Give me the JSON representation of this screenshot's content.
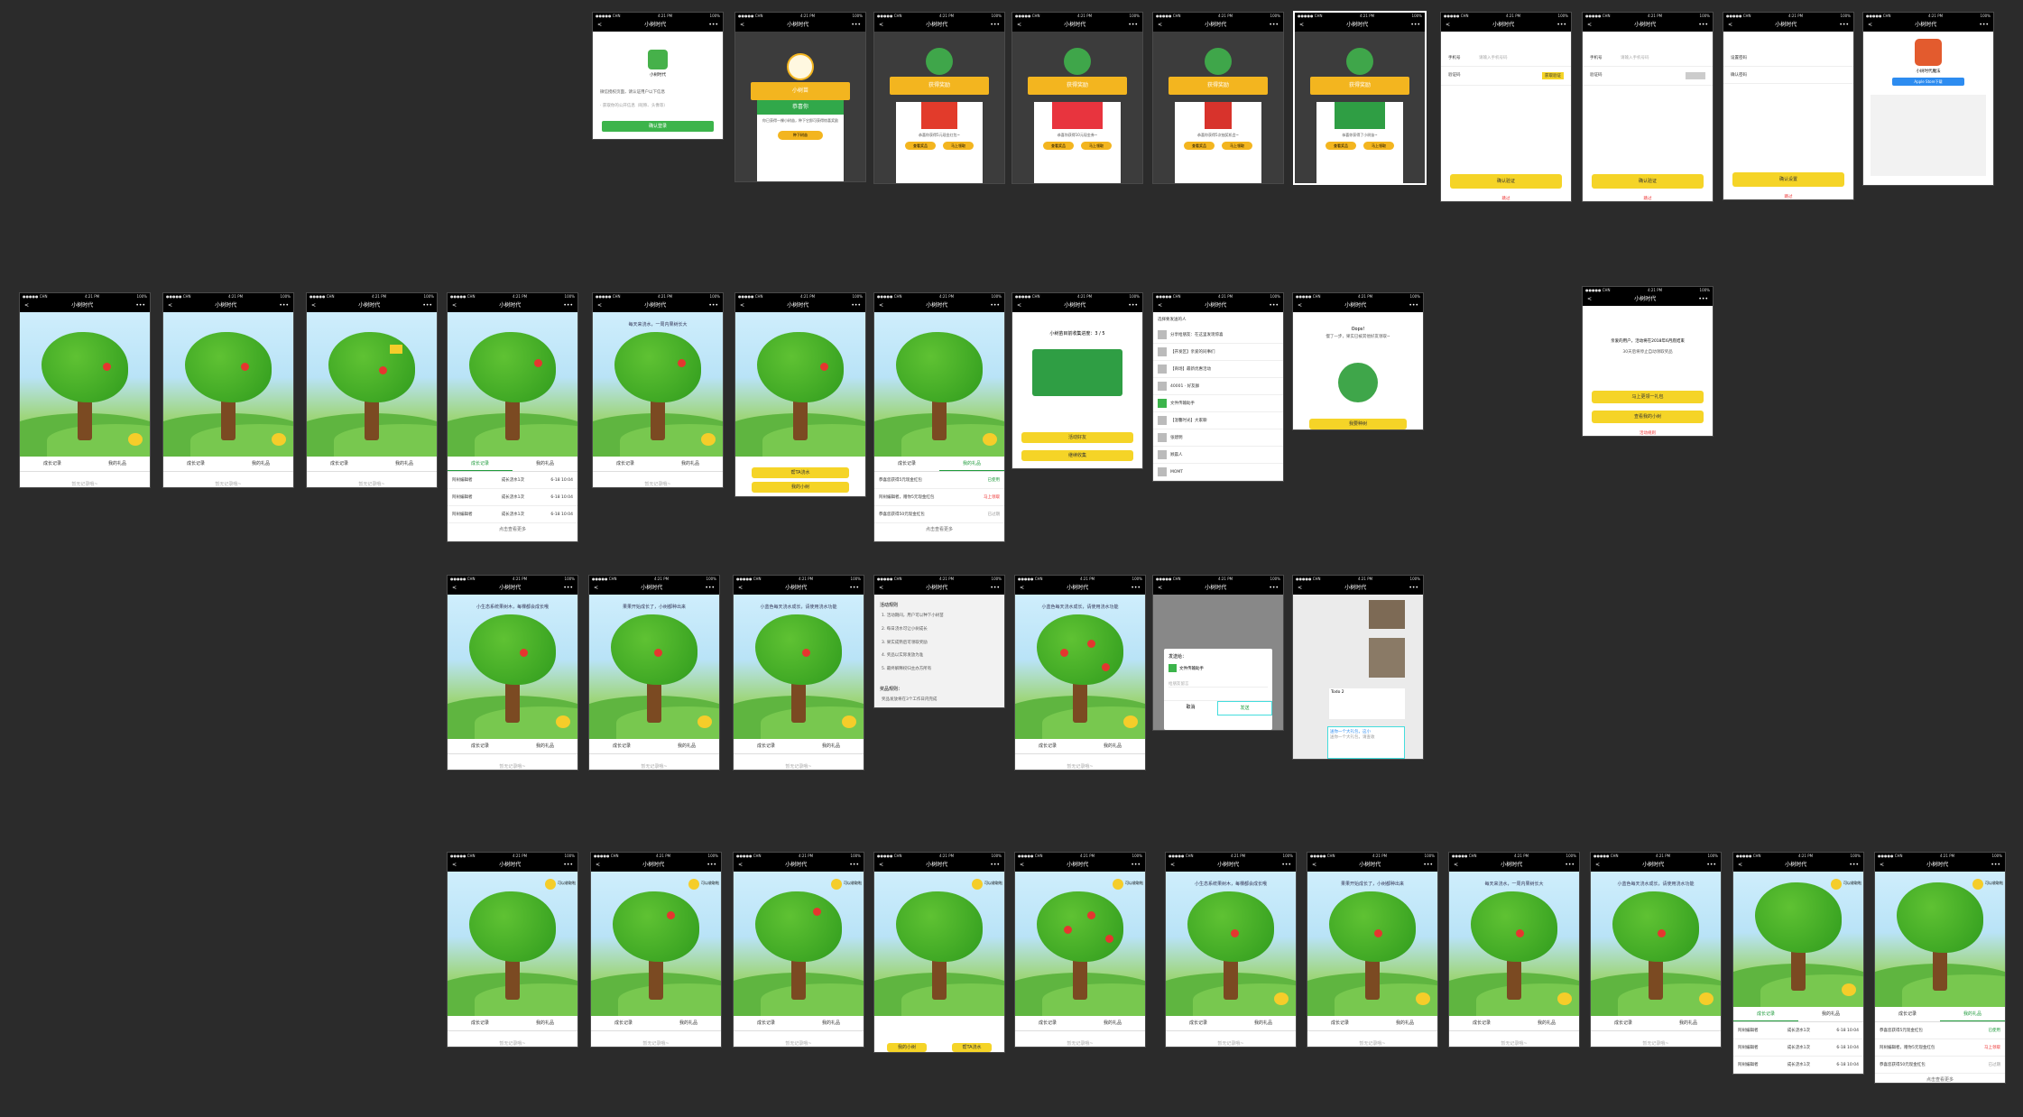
{
  "common": {
    "status_left": "●●●●● CHN",
    "status_time": "4:21 PM",
    "status_right": "100%",
    "nav_title": "小树时代",
    "back": "<",
    "more": "•••",
    "tab_growth": "成长记录",
    "tab_gift": "我的礼品",
    "empty": "暂无记录哦~"
  },
  "row1": {
    "auth_brand": "小树时代",
    "auth_line1": "微信授权页面，请认证用户以下信息",
    "auth_line2": "·  获取你的公开信息（昵称、头像等）",
    "auth_btn": "确认登录",
    "tree_banner": "小树苗",
    "tree_green": "恭喜你",
    "tree_txt": "你已获得一棵小树苗，种下它即可获得惊喜奖励",
    "tree_btn": "种下树苗",
    "reward_banner": "获得奖励",
    "reward_txt1": "恭喜你获得5元现金红包~",
    "reward_txt2": "恭喜你获得10元现金券~",
    "reward_txt3": "恭喜你获得5次抽奖机会~",
    "reward_txt4": "恭喜你获得了小树苗~",
    "btn_view": "查看奖品",
    "btn_use": "马上领取",
    "phone_label": "手机号",
    "phone_val": "请输入手机号码",
    "code_label": "验证码",
    "code_btn": "获取验证",
    "confirm_verify": "确认验证",
    "confirm_set": "确认设置",
    "setpwd_label": "设置密码",
    "confirm_pwd_label": "确认密码",
    "skip": "跳过",
    "app_name": "小树时代魔法",
    "app_btn": "Apple Store下载"
  },
  "row2": {
    "sky1": "现在有3颗果子，每天都可以收取",
    "sky2": "每天来浇水，一周内果树长大",
    "record1": "阿树编辑者",
    "record1b": "成长浇水1次",
    "record_time": "6-18 10:04",
    "more_records": "点击查看更多",
    "progress": "小树苗目前收集进度：3 / 5",
    "share_btn": "活动好友",
    "continue_btn": "继续收集",
    "water_btn": "帮TA浇水",
    "my_tree_btn": "我的小树",
    "gift1": "恭喜您获得5元现金红包",
    "gift1s": "已使用",
    "gift2": "阿树编辑者，赠你5元现金红包",
    "gift2s": "马上领取",
    "gift3": "恭喜您获得50元现金红包",
    "gift3s": "已过期",
    "chat_title": "选择要发送的人",
    "chat_items": [
      "分享给朋友：在这里发现惊喜",
      "【开发区】亲爱的同事们",
      "【商场】最新优惠活动",
      "40001 · 好友群",
      "文件传输助手",
      "【温馨时光】大家聊",
      "张建明",
      "顾晨人",
      "MOMT"
    ],
    "oops_t1": "Oops!",
    "oops_t2": "慢了一步，果实已被其他好友领取~",
    "oops_btn": "我要种树",
    "end_t1": "亲爱的用户，活动将在2018年6月底结束",
    "end_t2": "30天后将停止自动领取奖品",
    "end_btn1": "马上更领一礼包",
    "end_btn2": "查看我的小树",
    "end_link": "活动规则"
  },
  "row3": {
    "sky_a": "小生态系统果树木，每棵都会成长哦",
    "sky_b": "果果开始成长了，小树都种出来",
    "sky_c": "小蓝色每天浇水成长，请使用浇水功能",
    "rules_title": "活动规则",
    "rules_lines": [
      "1. 活动期间，用户可以种下小树苗",
      "2. 每日浇水可让小树成长",
      "3. 果实成熟后可领取奖励",
      "4. 奖品以实际发放为准",
      "5. 最终解释权归主办方所有"
    ],
    "prize_title": "奖品规则：",
    "prize_line": "奖品发放将在3个工作日内完成",
    "dialog_title": "发送给：",
    "dialog_target": "文件传输助手",
    "dialog_hint": "给朋友留言",
    "dialog_cancel": "取消",
    "dialog_send": "发送",
    "msg_title": "Todo 2",
    "msg_card": "送你一个大礼包，这小",
    "msg_card2": "送你一个大礼包，请查收"
  },
  "row4": {
    "bubble": "可以收取啦",
    "water_btn": "帮TA浇水",
    "my_tree_btn": "我的小树",
    "sky_top": "小生态系统果树木，每棵都会成长哦"
  }
}
